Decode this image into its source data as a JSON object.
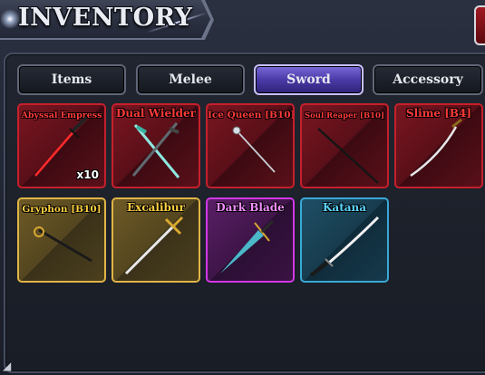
{
  "window": {
    "title": "INVENTORY"
  },
  "tabs": [
    {
      "label": "Items",
      "active": false
    },
    {
      "label": "Melee",
      "active": false
    },
    {
      "label": "Sword",
      "active": true
    },
    {
      "label": "Accessory",
      "active": false
    }
  ],
  "items": [
    {
      "name": "Abyssal Empress",
      "rarity": "red",
      "count": "x10"
    },
    {
      "name": "Dual Wielder",
      "rarity": "red"
    },
    {
      "name": "Ice Queen [B10]",
      "rarity": "red"
    },
    {
      "name": "Soul Reaper [B10]",
      "rarity": "red"
    },
    {
      "name": "Slime [B4]",
      "rarity": "red"
    },
    {
      "name": "Gryphon [B10]",
      "rarity": "gold"
    },
    {
      "name": "Excalibur",
      "rarity": "gold"
    },
    {
      "name": "Dark Blade",
      "rarity": "purple"
    },
    {
      "name": "Katana",
      "rarity": "blue"
    }
  ],
  "colors": {
    "red": "#c5202c",
    "gold": "#e0b547",
    "purple": "#d237e6",
    "blue": "#3aa8d8",
    "active_tab": "#5a49c0"
  },
  "icons": {
    "close": "close-icon",
    "resize": "resize-corner-icon"
  }
}
